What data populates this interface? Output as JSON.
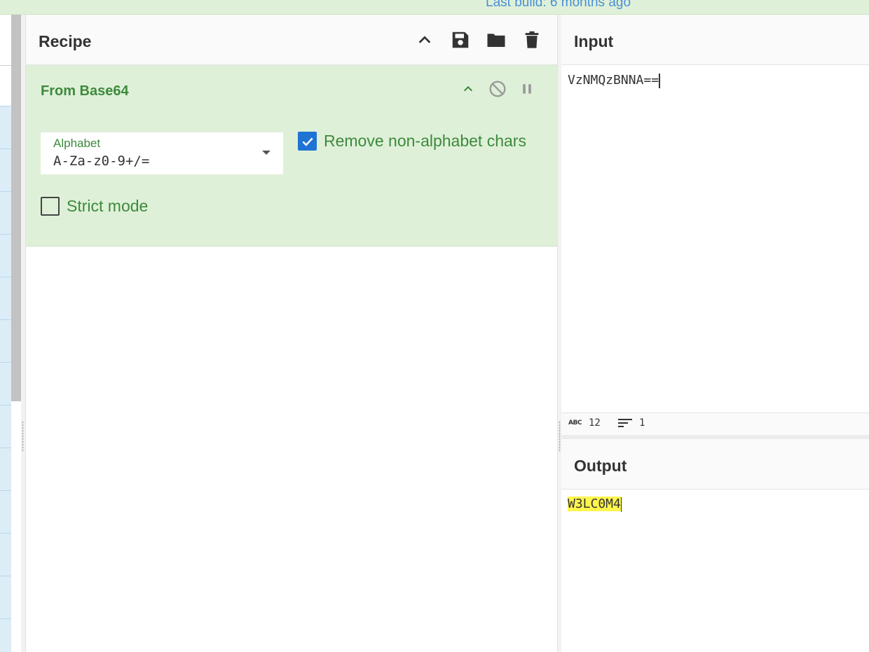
{
  "banner": {
    "last_build": "Last build: 6 months ago"
  },
  "recipe": {
    "title": "Recipe",
    "operation": {
      "name": "From Base64",
      "alphabet_label": "Alphabet",
      "alphabet_value": "A-Za-z0-9+/=",
      "remove_non_alphabet_label": "Remove non-alphabet chars",
      "remove_non_alphabet_checked": true,
      "strict_mode_label": "Strict mode",
      "strict_mode_checked": false
    }
  },
  "input": {
    "title": "Input",
    "text": "VzNMQzBNNA==",
    "length": "12",
    "lines": "1"
  },
  "output": {
    "title": "Output",
    "text": "W3LC0M4"
  },
  "colors": {
    "accent_green": "#3c8a3c",
    "operation_bg": "#dff0d8",
    "checkbox_blue": "#1f73d3",
    "highlight": "#fff54d"
  }
}
